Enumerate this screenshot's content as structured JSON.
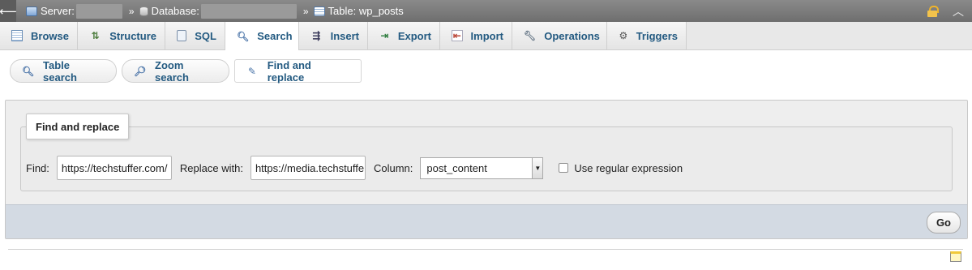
{
  "breadcrumb": {
    "server_label": "Server:",
    "database_label": "Database:",
    "table_label": "Table: wp_posts",
    "separator": "»"
  },
  "tabs": [
    {
      "label": "Browse",
      "icon": "browse-icon"
    },
    {
      "label": "Structure",
      "icon": "structure-icon"
    },
    {
      "label": "SQL",
      "icon": "sql-icon"
    },
    {
      "label": "Search",
      "icon": "search-icon"
    },
    {
      "label": "Insert",
      "icon": "insert-icon"
    },
    {
      "label": "Export",
      "icon": "export-icon"
    },
    {
      "label": "Import",
      "icon": "import-icon"
    },
    {
      "label": "Operations",
      "icon": "operations-icon"
    },
    {
      "label": "Triggers",
      "icon": "triggers-icon"
    }
  ],
  "active_tab": "Search",
  "subtabs": [
    {
      "label": "Table search",
      "icon": "magnifier-icon"
    },
    {
      "label": "Zoom search",
      "icon": "zoom-icon"
    },
    {
      "label": "Find and replace",
      "icon": "find-replace-icon"
    }
  ],
  "active_subtab": "Find and replace",
  "form": {
    "legend": "Find and replace",
    "find_label": "Find:",
    "find_value": "https://techstuffer.com/",
    "replace_label": "Replace with:",
    "replace_value": "https://media.techstuffer.com/",
    "column_label": "Column:",
    "column_value": "post_content",
    "regex_label": "Use regular expression",
    "regex_checked": false,
    "go_label": "Go"
  },
  "colors": {
    "link": "#235a81",
    "topbar": "#7a7a7a",
    "footer": "#d3dae3"
  }
}
